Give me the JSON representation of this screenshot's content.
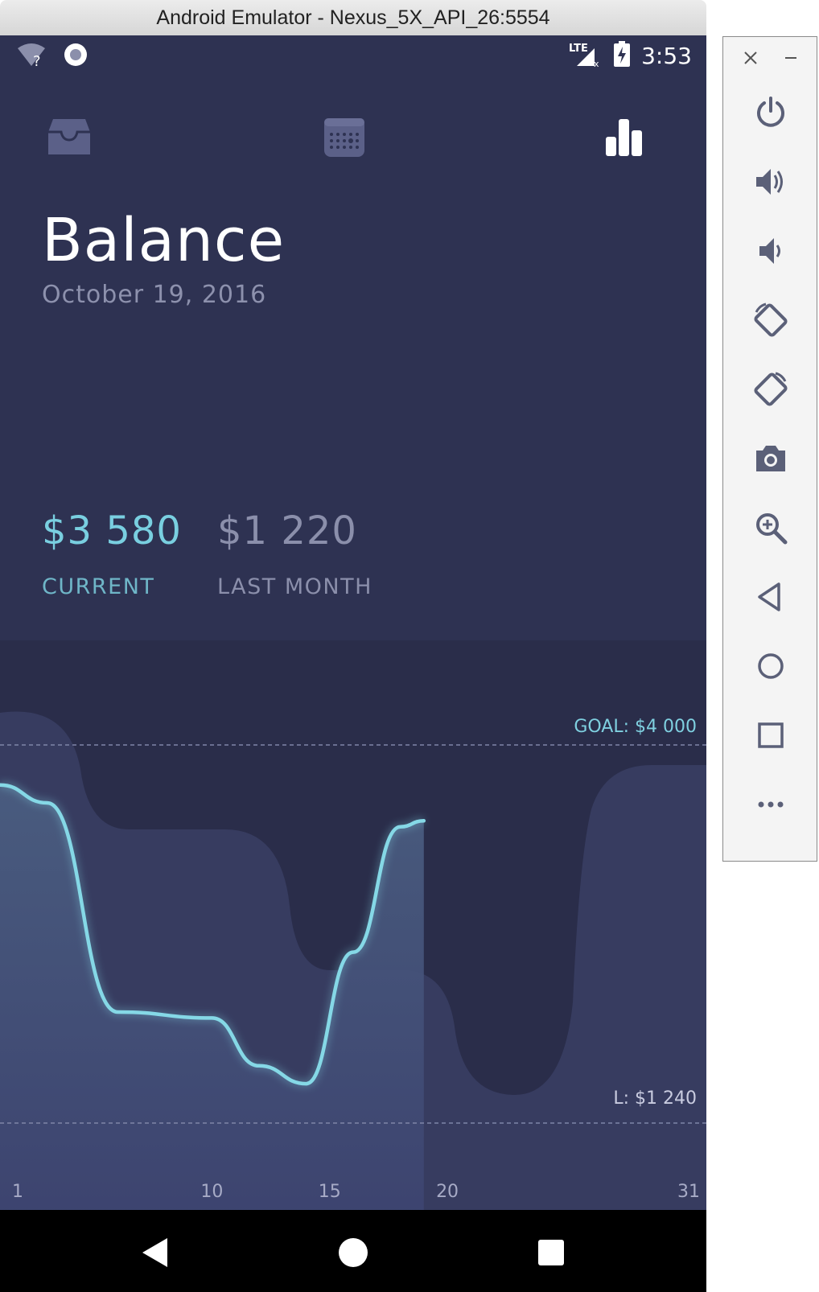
{
  "window": {
    "title": "Android Emulator - Nexus_5X_API_26:5554"
  },
  "status_bar": {
    "time": "3:53",
    "network": "LTE"
  },
  "nav_tabs": [
    {
      "icon": "inbox-icon"
    },
    {
      "icon": "calendar-icon"
    },
    {
      "icon": "bar-chart-icon",
      "active": true
    }
  ],
  "header": {
    "title": "Balance",
    "date": "October 19, 2016"
  },
  "stats": {
    "current": {
      "value": "$3 580",
      "label": "CURRENT"
    },
    "last_month": {
      "value": "$1 220",
      "label": "LAST MONTH"
    }
  },
  "chart_data": {
    "type": "line",
    "x_ticks": [
      "1",
      "10",
      "15",
      "20",
      "31"
    ],
    "goal_label": "GOAL: $4 000",
    "low_label": "L: $1 240",
    "series": [
      {
        "name": "current",
        "x": [
          1,
          3,
          6,
          10,
          12,
          14,
          16,
          18,
          19
        ],
        "y": [
          3800,
          3650,
          1900,
          1850,
          1450,
          1300,
          2400,
          3450,
          3500
        ]
      }
    ],
    "colors": {
      "line": "#85d8e6",
      "background": "#2e3252",
      "band": "#363b60"
    }
  },
  "system_nav": {
    "back": "back-icon",
    "home": "home-icon",
    "recents": "recents-icon"
  },
  "emulator_toolbar": [
    "power-icon",
    "volume-up-icon",
    "volume-down-icon",
    "rotate-left-icon",
    "rotate-right-icon",
    "camera-icon",
    "zoom-icon",
    "back-triangle-icon",
    "home-circle-icon",
    "overview-square-icon",
    "more-icon"
  ]
}
